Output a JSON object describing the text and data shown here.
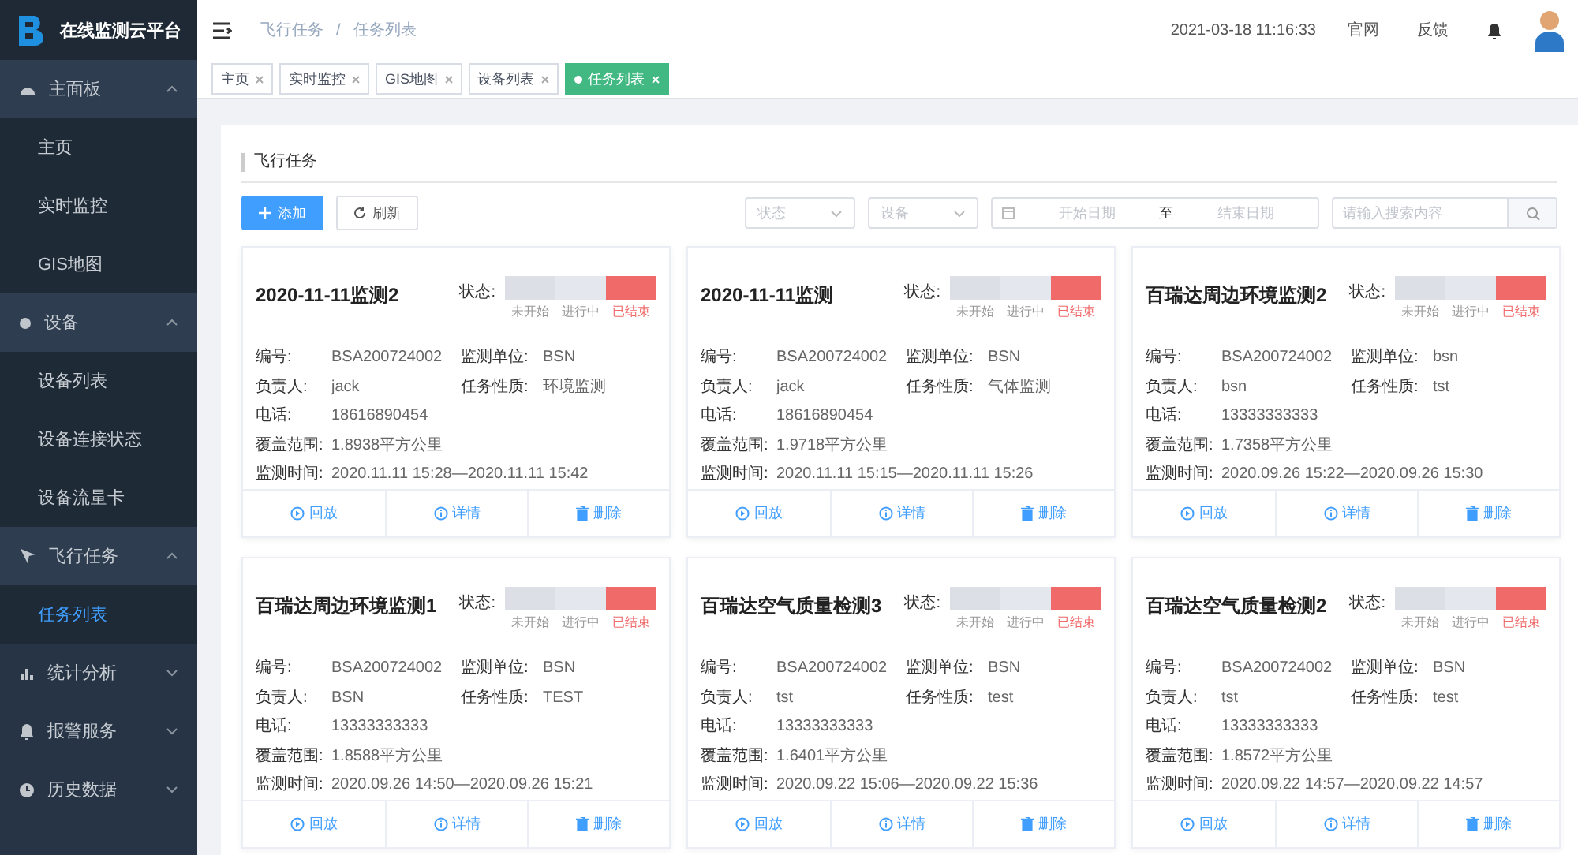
{
  "sidebar": {
    "logo_text": "在线监测云平台",
    "groups": [
      {
        "label": "主面板",
        "kind": "dashboard",
        "expanded": true,
        "items": [
          {
            "label": "主页",
            "selected": false
          },
          {
            "label": "实时监控",
            "selected": false
          },
          {
            "label": "GIS地图",
            "selected": false
          }
        ]
      },
      {
        "label": "设备",
        "kind": "device",
        "expanded": true,
        "items": [
          {
            "label": "设备列表",
            "selected": false
          },
          {
            "label": "设备连接状态",
            "selected": false
          },
          {
            "label": "设备流量卡",
            "selected": false
          }
        ]
      },
      {
        "label": "飞行任务",
        "kind": "flight",
        "expanded": true,
        "items": [
          {
            "label": "任务列表",
            "selected": true
          }
        ]
      },
      {
        "label": "统计分析",
        "kind": "statistics",
        "expanded": false
      },
      {
        "label": "报警服务",
        "kind": "alarm",
        "expanded": false
      },
      {
        "label": "历史数据",
        "kind": "history",
        "expanded": false
      }
    ]
  },
  "header": {
    "breadcrumb": [
      "飞行任务",
      "任务列表"
    ],
    "breadcrumb_separator": "/",
    "datetime": "2021-03-18 11:16:33",
    "links": [
      "官网",
      "反馈"
    ]
  },
  "tags": [
    {
      "label": "主页",
      "selected": false
    },
    {
      "label": "实时监控",
      "selected": false
    },
    {
      "label": "GIS地图",
      "selected": false
    },
    {
      "label": "设备列表",
      "selected": false
    },
    {
      "label": "任务列表",
      "selected": true
    }
  ],
  "panel": {
    "title": "飞行任务",
    "buttons": [
      {
        "kind": "add",
        "label": "添加"
      },
      {
        "kind": "refresh",
        "label": "刷新"
      }
    ],
    "filters": {
      "status_placeholder": "状态",
      "device_placeholder": "设备",
      "start_placeholder": "开始日期",
      "separator": "至",
      "end_placeholder": "结束日期",
      "search_placeholder": "请输入搜索内容"
    }
  },
  "cards": [
    {
      "title": "2020-11-11监测2",
      "status_label": "状态:",
      "stages": [
        {
          "label": "未开始",
          "selected": false
        },
        {
          "label": "进行中",
          "selected": false
        },
        {
          "label": "已结束",
          "selected": true
        }
      ],
      "rows": [
        [
          {
            "label": "编号:",
            "value": "BSA200724002"
          },
          {
            "label": "监测单位:",
            "value": "BSN"
          }
        ],
        [
          {
            "label": "负责人:",
            "value": "jack"
          },
          {
            "label": "任务性质:",
            "value": "环境监测"
          }
        ],
        [
          {
            "label": "电话:",
            "value": "18616890454"
          }
        ],
        [
          {
            "label": "覆盖范围:",
            "value": "1.8938平方公里"
          }
        ],
        [
          {
            "label": "监测时间:",
            "value": "2020.11.11 15:28—2020.11.11 15:42"
          }
        ]
      ],
      "actions": [
        {
          "kind": "replay",
          "label": "回放"
        },
        {
          "kind": "info",
          "label": "详情"
        },
        {
          "kind": "delete",
          "label": "删除"
        }
      ]
    },
    {
      "title": "2020-11-11监测",
      "status_label": "状态:",
      "stages": [
        {
          "label": "未开始",
          "selected": false
        },
        {
          "label": "进行中",
          "selected": false
        },
        {
          "label": "已结束",
          "selected": true
        }
      ],
      "rows": [
        [
          {
            "label": "编号:",
            "value": "BSA200724002"
          },
          {
            "label": "监测单位:",
            "value": "BSN"
          }
        ],
        [
          {
            "label": "负责人:",
            "value": "jack"
          },
          {
            "label": "任务性质:",
            "value": "气体监测"
          }
        ],
        [
          {
            "label": "电话:",
            "value": "18616890454"
          }
        ],
        [
          {
            "label": "覆盖范围:",
            "value": "1.9718平方公里"
          }
        ],
        [
          {
            "label": "监测时间:",
            "value": "2020.11.11 15:15—2020.11.11 15:26"
          }
        ]
      ],
      "actions": [
        {
          "kind": "replay",
          "label": "回放"
        },
        {
          "kind": "info",
          "label": "详情"
        },
        {
          "kind": "delete",
          "label": "删除"
        }
      ]
    },
    {
      "title": "百瑞达周边环境监测2",
      "status_label": "状态:",
      "stages": [
        {
          "label": "未开始",
          "selected": false
        },
        {
          "label": "进行中",
          "selected": false
        },
        {
          "label": "已结束",
          "selected": true
        }
      ],
      "rows": [
        [
          {
            "label": "编号:",
            "value": "BSA200724002"
          },
          {
            "label": "监测单位:",
            "value": "bsn"
          }
        ],
        [
          {
            "label": "负责人:",
            "value": "bsn"
          },
          {
            "label": "任务性质:",
            "value": "tst"
          }
        ],
        [
          {
            "label": "电话:",
            "value": "13333333333"
          }
        ],
        [
          {
            "label": "覆盖范围:",
            "value": "1.7358平方公里"
          }
        ],
        [
          {
            "label": "监测时间:",
            "value": "2020.09.26 15:22—2020.09.26 15:30"
          }
        ]
      ],
      "actions": [
        {
          "kind": "replay",
          "label": "回放"
        },
        {
          "kind": "info",
          "label": "详情"
        },
        {
          "kind": "delete",
          "label": "删除"
        }
      ]
    },
    {
      "title": "百瑞达周边环境监测1",
      "status_label": "状态:",
      "stages": [
        {
          "label": "未开始",
          "selected": false
        },
        {
          "label": "进行中",
          "selected": false
        },
        {
          "label": "已结束",
          "selected": true
        }
      ],
      "rows": [
        [
          {
            "label": "编号:",
            "value": "BSA200724002"
          },
          {
            "label": "监测单位:",
            "value": "BSN"
          }
        ],
        [
          {
            "label": "负责人:",
            "value": "BSN"
          },
          {
            "label": "任务性质:",
            "value": "TEST"
          }
        ],
        [
          {
            "label": "电话:",
            "value": "13333333333"
          }
        ],
        [
          {
            "label": "覆盖范围:",
            "value": "1.8588平方公里"
          }
        ],
        [
          {
            "label": "监测时间:",
            "value": "2020.09.26 14:50—2020.09.26 15:21"
          }
        ]
      ],
      "actions": [
        {
          "kind": "replay",
          "label": "回放"
        },
        {
          "kind": "info",
          "label": "详情"
        },
        {
          "kind": "delete",
          "label": "删除"
        }
      ]
    },
    {
      "title": "百瑞达空气质量检测3",
      "status_label": "状态:",
      "stages": [
        {
          "label": "未开始",
          "selected": false
        },
        {
          "label": "进行中",
          "selected": false
        },
        {
          "label": "已结束",
          "selected": true
        }
      ],
      "rows": [
        [
          {
            "label": "编号:",
            "value": "BSA200724002"
          },
          {
            "label": "监测单位:",
            "value": "BSN"
          }
        ],
        [
          {
            "label": "负责人:",
            "value": "tst"
          },
          {
            "label": "任务性质:",
            "value": "test"
          }
        ],
        [
          {
            "label": "电话:",
            "value": "13333333333"
          }
        ],
        [
          {
            "label": "覆盖范围:",
            "value": "1.6401平方公里"
          }
        ],
        [
          {
            "label": "监测时间:",
            "value": "2020.09.22 15:06—2020.09.22 15:36"
          }
        ]
      ],
      "actions": [
        {
          "kind": "replay",
          "label": "回放"
        },
        {
          "kind": "info",
          "label": "详情"
        },
        {
          "kind": "delete",
          "label": "删除"
        }
      ]
    },
    {
      "title": "百瑞达空气质量检测2",
      "status_label": "状态:",
      "stages": [
        {
          "label": "未开始",
          "selected": false
        },
        {
          "label": "进行中",
          "selected": false
        },
        {
          "label": "已结束",
          "selected": true
        }
      ],
      "rows": [
        [
          {
            "label": "编号:",
            "value": "BSA200724002"
          },
          {
            "label": "监测单位:",
            "value": "BSN"
          }
        ],
        [
          {
            "label": "负责人:",
            "value": "tst"
          },
          {
            "label": "任务性质:",
            "value": "test"
          }
        ],
        [
          {
            "label": "电话:",
            "value": "13333333333"
          }
        ],
        [
          {
            "label": "覆盖范围:",
            "value": "1.8572平方公里"
          }
        ],
        [
          {
            "label": "监测时间:",
            "value": "2020.09.22 14:57—2020.09.22 14:57"
          }
        ]
      ],
      "actions": [
        {
          "kind": "replay",
          "label": "回放"
        },
        {
          "kind": "info",
          "label": "详情"
        },
        {
          "kind": "delete",
          "label": "删除"
        }
      ]
    }
  ]
}
